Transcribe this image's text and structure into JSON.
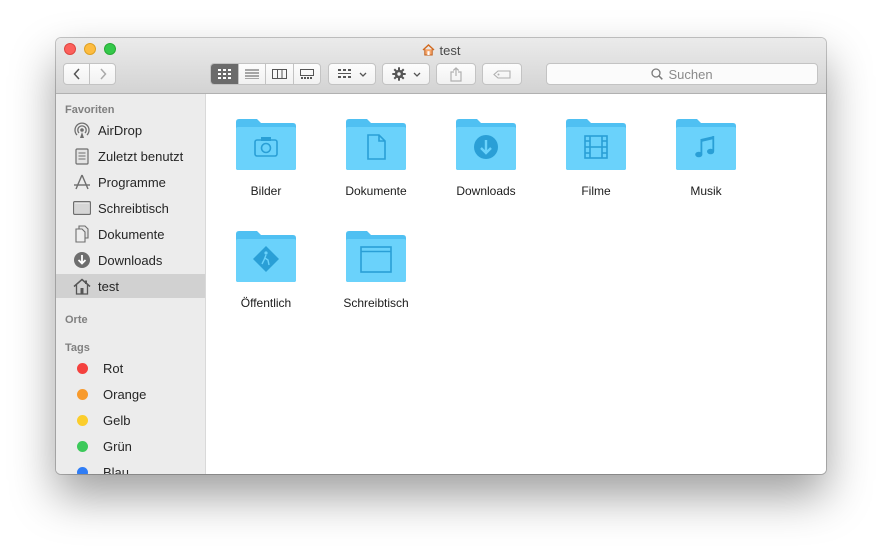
{
  "window": {
    "title": "test",
    "title_icon": "home-icon"
  },
  "toolbar": {
    "back_icon": "chevron-left-icon",
    "forward_icon": "chevron-right-icon",
    "view_modes": [
      "icon-view",
      "list-view",
      "column-view",
      "gallery-view"
    ],
    "active_view": "icon-view",
    "group_icon": "group-icon",
    "action_icon": "gear-icon",
    "share_icon": "share-icon",
    "tag_icon": "tag-icon",
    "search_placeholder": "Suchen"
  },
  "sidebar": {
    "favorites_label": "Favoriten",
    "favorites": [
      {
        "label": "AirDrop",
        "icon": "airdrop-icon"
      },
      {
        "label": "Zuletzt benutzt",
        "icon": "recents-icon"
      },
      {
        "label": "Programme",
        "icon": "applications-icon"
      },
      {
        "label": "Schreibtisch",
        "icon": "desktop-icon"
      },
      {
        "label": "Dokumente",
        "icon": "documents-icon"
      },
      {
        "label": "Downloads",
        "icon": "downloads-icon"
      },
      {
        "label": "test",
        "icon": "home-icon",
        "selected": true
      }
    ],
    "locations_label": "Orte",
    "tags_label": "Tags",
    "tags": [
      {
        "label": "Rot",
        "color": "#f4413e"
      },
      {
        "label": "Orange",
        "color": "#f89a2c"
      },
      {
        "label": "Gelb",
        "color": "#fbcd2c"
      },
      {
        "label": "Grün",
        "color": "#3cc95a"
      },
      {
        "label": "Blau",
        "color": "#2f7df6"
      }
    ]
  },
  "content": {
    "folder_color": "#5ac8fa",
    "folders": [
      {
        "label": "Bilder",
        "icon": "camera-icon"
      },
      {
        "label": "Dokumente",
        "icon": "document-icon"
      },
      {
        "label": "Downloads",
        "icon": "download-arrow-icon"
      },
      {
        "label": "Filme",
        "icon": "film-icon"
      },
      {
        "label": "Musik",
        "icon": "music-note-icon"
      },
      {
        "label": "Öffentlich",
        "icon": "public-icon"
      },
      {
        "label": "Schreibtisch",
        "icon": "desktop-window-icon"
      }
    ]
  }
}
